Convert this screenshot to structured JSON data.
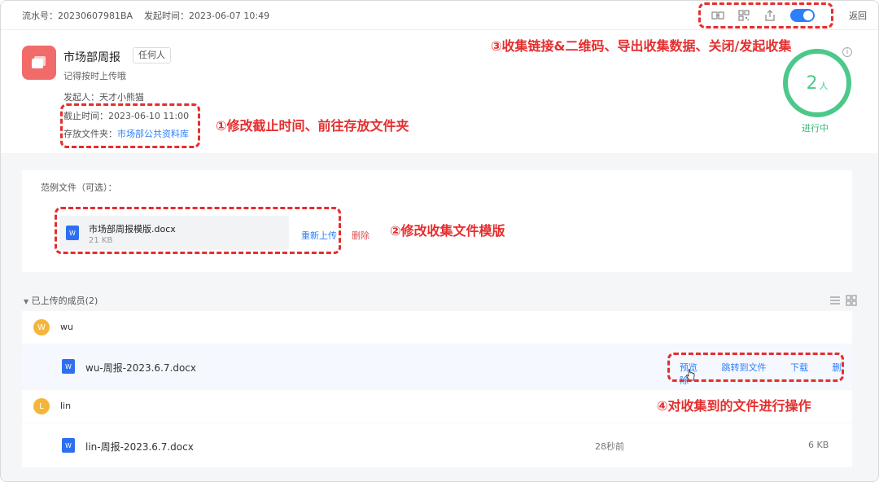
{
  "topbar": {
    "serial_text": "流水号：20230607981BA",
    "time_text": "发起时间：2023-06-07 10:49",
    "back_label": "返回",
    "icons": [
      "link-icon",
      "qrcode-icon",
      "export-icon",
      "toggle-switch"
    ],
    "toggle_on": true
  },
  "header": {
    "title": "市场部周报",
    "tag": "任何人",
    "description": "记得按时上传哦",
    "initiator": "发起人：天才小熊猫",
    "deadline": "截止时间：2023-06-10 11:00",
    "folder_label": "存放文件夹：",
    "folder_link": "市场部公共资料库",
    "count": "2",
    "count_unit": "人",
    "status": "进行中"
  },
  "sample": {
    "label": "范例文件（可选）：",
    "file_name": "市场部周报模版.docx",
    "file_size": "21 KB",
    "reupload_label": "重新上传",
    "delete_label": "删除"
  },
  "members": {
    "header": "已上传的成员(2)",
    "list": [
      {
        "initial": "W",
        "name": "wu",
        "file": "wu-周报-2023.6.7.docx",
        "actions": [
          "预览",
          "跳转到文件",
          "下载",
          "删除"
        ]
      },
      {
        "initial": "L",
        "name": "lin",
        "file": "lin-周报-2023.6.7.docx",
        "time_ago": "28秒前",
        "size": "6 KB"
      }
    ]
  },
  "annotations": {
    "a1": "①修改截止时间、前往存放文件夹",
    "a2": "②修改收集文件模版",
    "a3": "③收集链接&二维码、导出收集数据、关闭/发起收集",
    "a4": "④对收集到的文件进行操作"
  },
  "colors": {
    "accent": "#2d7ff9",
    "success": "#4cc98a",
    "danger": "#e34d4d",
    "annotation": "#e52e2e",
    "app_icon": "#f26b6b",
    "avatar": "#f4b63a"
  }
}
